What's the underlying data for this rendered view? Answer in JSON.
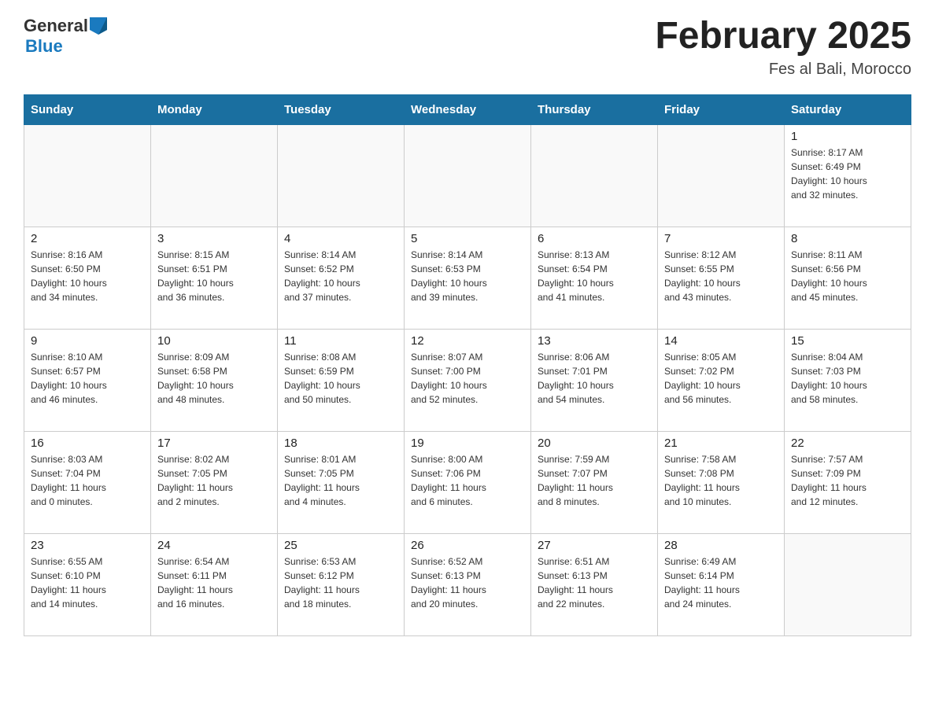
{
  "header": {
    "logo_general": "General",
    "logo_blue": "Blue",
    "title": "February 2025",
    "subtitle": "Fes al Bali, Morocco"
  },
  "weekdays": [
    "Sunday",
    "Monday",
    "Tuesday",
    "Wednesday",
    "Thursday",
    "Friday",
    "Saturday"
  ],
  "weeks": [
    [
      {
        "day": "",
        "info": ""
      },
      {
        "day": "",
        "info": ""
      },
      {
        "day": "",
        "info": ""
      },
      {
        "day": "",
        "info": ""
      },
      {
        "day": "",
        "info": ""
      },
      {
        "day": "",
        "info": ""
      },
      {
        "day": "1",
        "info": "Sunrise: 8:17 AM\nSunset: 6:49 PM\nDaylight: 10 hours\nand 32 minutes."
      }
    ],
    [
      {
        "day": "2",
        "info": "Sunrise: 8:16 AM\nSunset: 6:50 PM\nDaylight: 10 hours\nand 34 minutes."
      },
      {
        "day": "3",
        "info": "Sunrise: 8:15 AM\nSunset: 6:51 PM\nDaylight: 10 hours\nand 36 minutes."
      },
      {
        "day": "4",
        "info": "Sunrise: 8:14 AM\nSunset: 6:52 PM\nDaylight: 10 hours\nand 37 minutes."
      },
      {
        "day": "5",
        "info": "Sunrise: 8:14 AM\nSunset: 6:53 PM\nDaylight: 10 hours\nand 39 minutes."
      },
      {
        "day": "6",
        "info": "Sunrise: 8:13 AM\nSunset: 6:54 PM\nDaylight: 10 hours\nand 41 minutes."
      },
      {
        "day": "7",
        "info": "Sunrise: 8:12 AM\nSunset: 6:55 PM\nDaylight: 10 hours\nand 43 minutes."
      },
      {
        "day": "8",
        "info": "Sunrise: 8:11 AM\nSunset: 6:56 PM\nDaylight: 10 hours\nand 45 minutes."
      }
    ],
    [
      {
        "day": "9",
        "info": "Sunrise: 8:10 AM\nSunset: 6:57 PM\nDaylight: 10 hours\nand 46 minutes."
      },
      {
        "day": "10",
        "info": "Sunrise: 8:09 AM\nSunset: 6:58 PM\nDaylight: 10 hours\nand 48 minutes."
      },
      {
        "day": "11",
        "info": "Sunrise: 8:08 AM\nSunset: 6:59 PM\nDaylight: 10 hours\nand 50 minutes."
      },
      {
        "day": "12",
        "info": "Sunrise: 8:07 AM\nSunset: 7:00 PM\nDaylight: 10 hours\nand 52 minutes."
      },
      {
        "day": "13",
        "info": "Sunrise: 8:06 AM\nSunset: 7:01 PM\nDaylight: 10 hours\nand 54 minutes."
      },
      {
        "day": "14",
        "info": "Sunrise: 8:05 AM\nSunset: 7:02 PM\nDaylight: 10 hours\nand 56 minutes."
      },
      {
        "day": "15",
        "info": "Sunrise: 8:04 AM\nSunset: 7:03 PM\nDaylight: 10 hours\nand 58 minutes."
      }
    ],
    [
      {
        "day": "16",
        "info": "Sunrise: 8:03 AM\nSunset: 7:04 PM\nDaylight: 11 hours\nand 0 minutes."
      },
      {
        "day": "17",
        "info": "Sunrise: 8:02 AM\nSunset: 7:05 PM\nDaylight: 11 hours\nand 2 minutes."
      },
      {
        "day": "18",
        "info": "Sunrise: 8:01 AM\nSunset: 7:05 PM\nDaylight: 11 hours\nand 4 minutes."
      },
      {
        "day": "19",
        "info": "Sunrise: 8:00 AM\nSunset: 7:06 PM\nDaylight: 11 hours\nand 6 minutes."
      },
      {
        "day": "20",
        "info": "Sunrise: 7:59 AM\nSunset: 7:07 PM\nDaylight: 11 hours\nand 8 minutes."
      },
      {
        "day": "21",
        "info": "Sunrise: 7:58 AM\nSunset: 7:08 PM\nDaylight: 11 hours\nand 10 minutes."
      },
      {
        "day": "22",
        "info": "Sunrise: 7:57 AM\nSunset: 7:09 PM\nDaylight: 11 hours\nand 12 minutes."
      }
    ],
    [
      {
        "day": "23",
        "info": "Sunrise: 6:55 AM\nSunset: 6:10 PM\nDaylight: 11 hours\nand 14 minutes."
      },
      {
        "day": "24",
        "info": "Sunrise: 6:54 AM\nSunset: 6:11 PM\nDaylight: 11 hours\nand 16 minutes."
      },
      {
        "day": "25",
        "info": "Sunrise: 6:53 AM\nSunset: 6:12 PM\nDaylight: 11 hours\nand 18 minutes."
      },
      {
        "day": "26",
        "info": "Sunrise: 6:52 AM\nSunset: 6:13 PM\nDaylight: 11 hours\nand 20 minutes."
      },
      {
        "day": "27",
        "info": "Sunrise: 6:51 AM\nSunset: 6:13 PM\nDaylight: 11 hours\nand 22 minutes."
      },
      {
        "day": "28",
        "info": "Sunrise: 6:49 AM\nSunset: 6:14 PM\nDaylight: 11 hours\nand 24 minutes."
      },
      {
        "day": "",
        "info": ""
      }
    ]
  ]
}
